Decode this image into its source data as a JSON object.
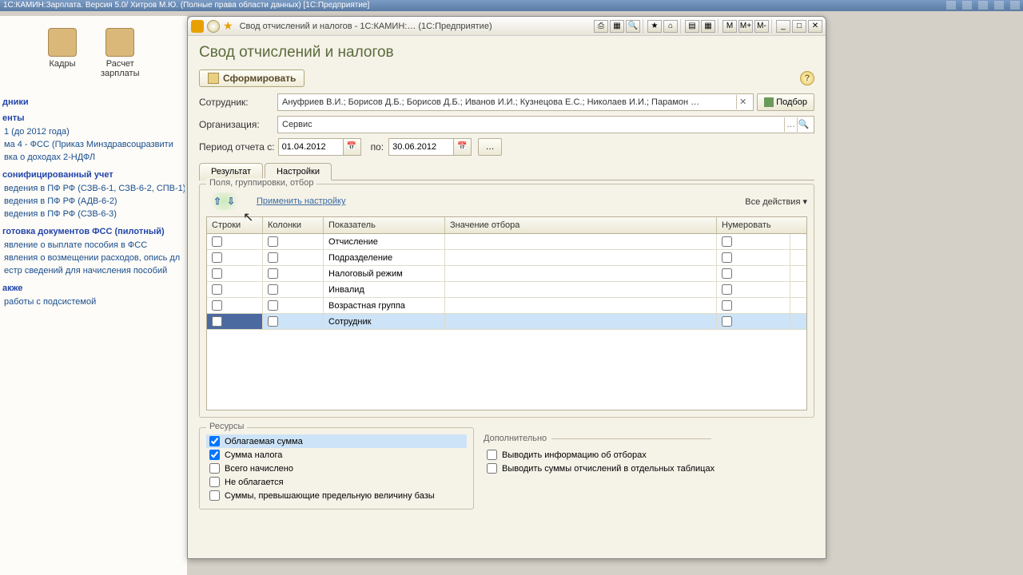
{
  "main_titlebar": "1С:КАМИН:Зарплата. Версия 5.0/ Хитров М.Ю. (Полные права области данных)  [1С:Предприятие]",
  "desktop_icons": [
    {
      "label": "Кадры"
    },
    {
      "label": "Расчет\nзарплаты"
    }
  ],
  "nav": {
    "s1": "дники",
    "s2": "енты",
    "i1": "1 (до 2012 года)",
    "i2": "ма 4 - ФСС (Приказ Минздравсоцразвити",
    "i3": "вка о доходах 2-НДФЛ",
    "s3": "сонифицированный учет",
    "i4": "ведения в ПФ РФ (СЗВ-6-1, СЗВ-6-2, СПВ-1)",
    "i5": "ведения в ПФ РФ (АДВ-6-2)",
    "i6": "ведения в ПФ РФ (СЗВ-6-3)",
    "s4": "готовка документов ФСС (пилотный)",
    "i7": "явление о выплате пособия в ФСС",
    "i8": "явления о возмещении расходов, опись дл",
    "i9": "естр сведений для начисления пособий",
    "s5": "акже",
    "i10": "работы с подсистемой"
  },
  "window": {
    "title": "Свод отчислений и налогов - 1С:КАМИН:…   (1С:Предприятие)",
    "page_title": "Свод отчислений и налогов",
    "btn_form": "Сформировать",
    "employee_label": "Сотрудник:",
    "employee_value": "Ануфриев В.И.; Борисов Д.Б.; Борисов Д.Б.; Иванов И.И.; Кузнецова Е.С.; Николаев И.И.; Парамон …",
    "btn_podbor": "Подбор",
    "org_label": "Организация:",
    "org_value": "Сервис",
    "period_label": "Период отчета с:",
    "period_from": "01.04.2012",
    "period_to_label": "по:",
    "period_to": "30.06.2012",
    "tabs": [
      "Результат",
      "Настройки"
    ],
    "group_title": "Поля, группировки, отбор",
    "apply_link": "Применить настройку",
    "all_actions": "Все действия ▾",
    "grid_headers": [
      "Строки",
      "Колонки",
      "Показатель",
      "Значение отбора",
      "Нумеровать"
    ],
    "grid_rows": [
      {
        "label": "Отчисление"
      },
      {
        "label": "Подразделение"
      },
      {
        "label": "Налоговый режим"
      },
      {
        "label": "Инвалид"
      },
      {
        "label": "Возрастная группа"
      },
      {
        "label": "Сотрудник",
        "selected": true
      }
    ],
    "resources_title": "Ресурсы",
    "resources": [
      {
        "label": "Облагаемая сумма",
        "checked": true,
        "sel": true
      },
      {
        "label": "Сумма налога",
        "checked": true
      },
      {
        "label": "Всего начислено",
        "checked": false
      },
      {
        "label": "Не облагается",
        "checked": false
      },
      {
        "label": "Суммы, превышающие предельную величину базы",
        "checked": false
      }
    ],
    "extra_title": "Дополнительно",
    "extra": [
      {
        "label": "Выводить информацию об отборах"
      },
      {
        "label": "Выводить суммы отчислений в отдельных таблицах"
      }
    ]
  }
}
